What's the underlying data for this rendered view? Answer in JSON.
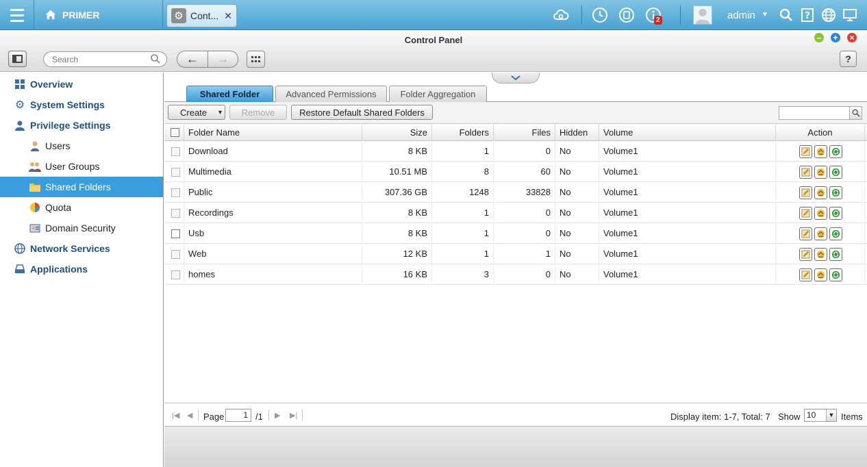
{
  "topbar": {
    "home_label": "PRIMER",
    "app_tab_label": "Cont...",
    "app_tab_close": "✕",
    "notification_count": "2",
    "username": "admin",
    "user_caret": "▼"
  },
  "window": {
    "title": "Control Panel",
    "minimize": "–",
    "maximize": "+",
    "close": "×",
    "search_placeholder": "Search",
    "back": "←",
    "forward": "→",
    "help": "?"
  },
  "sidebar": {
    "items": [
      {
        "label": "Overview",
        "level": 1,
        "icon": "overview-icon"
      },
      {
        "label": "System Settings",
        "level": 1,
        "icon": "gear-icon"
      },
      {
        "label": "Privilege Settings",
        "level": 1,
        "icon": "user-icon"
      },
      {
        "label": "Users",
        "level": 2,
        "icon": "user-icon"
      },
      {
        "label": "User Groups",
        "level": 2,
        "icon": "user-group-icon"
      },
      {
        "label": "Shared Folders",
        "level": 2,
        "icon": "folder-icon",
        "active": true
      },
      {
        "label": "Quota",
        "level": 2,
        "icon": "pie-icon"
      },
      {
        "label": "Domain Security",
        "level": 2,
        "icon": "domain-icon"
      },
      {
        "label": "Network Services",
        "level": 1,
        "icon": "globe-icon"
      },
      {
        "label": "Applications",
        "level": 1,
        "icon": "applications-icon"
      }
    ]
  },
  "tabs": [
    {
      "label": "Shared Folder",
      "active": true
    },
    {
      "label": "Advanced Permissions",
      "active": false
    },
    {
      "label": "Folder Aggregation",
      "active": false
    }
  ],
  "toolbar": {
    "create_label": "Create",
    "create_caret": "▾",
    "remove_label": "Remove",
    "restore_label": "Restore Default Shared Folders"
  },
  "table": {
    "columns": [
      "Folder Name",
      "Size",
      "Folders",
      "Files",
      "Hidden",
      "Volume",
      "Action"
    ],
    "rows": [
      {
        "name": "Download",
        "size": "8 KB",
        "folders": "1",
        "files": "0",
        "hidden": "No",
        "volume": "Volume1"
      },
      {
        "name": "Multimedia",
        "size": "10.51 MB",
        "folders": "8",
        "files": "60",
        "hidden": "No",
        "volume": "Volume1"
      },
      {
        "name": "Public",
        "size": "307.36 GB",
        "folders": "1248",
        "files": "33828",
        "hidden": "No",
        "volume": "Volume1"
      },
      {
        "name": "Recordings",
        "size": "8 KB",
        "folders": "1",
        "files": "0",
        "hidden": "No",
        "volume": "Volume1"
      },
      {
        "name": "Usb",
        "size": "8 KB",
        "folders": "1",
        "files": "0",
        "hidden": "No",
        "volume": "Volume1"
      },
      {
        "name": "Web",
        "size": "12 KB",
        "folders": "1",
        "files": "1",
        "hidden": "No",
        "volume": "Volume1"
      },
      {
        "name": "homes",
        "size": "16 KB",
        "folders": "3",
        "files": "0",
        "hidden": "No",
        "volume": "Volume1"
      }
    ]
  },
  "pager": {
    "page_label": "Page",
    "page_value": "1",
    "page_total": "/1",
    "display_text": "Display item: 1-7, Total: 7",
    "show_label": "Show",
    "show_value": "10",
    "items_label": "Items",
    "first": "|◀",
    "prev": "◀",
    "next": "▶",
    "last": "▶|",
    "select_arrow": "▼"
  },
  "colors": {
    "topbar": "#4aa3d2",
    "active_item": "#3a9ede",
    "sidebar_text": "#1b4f8a"
  }
}
